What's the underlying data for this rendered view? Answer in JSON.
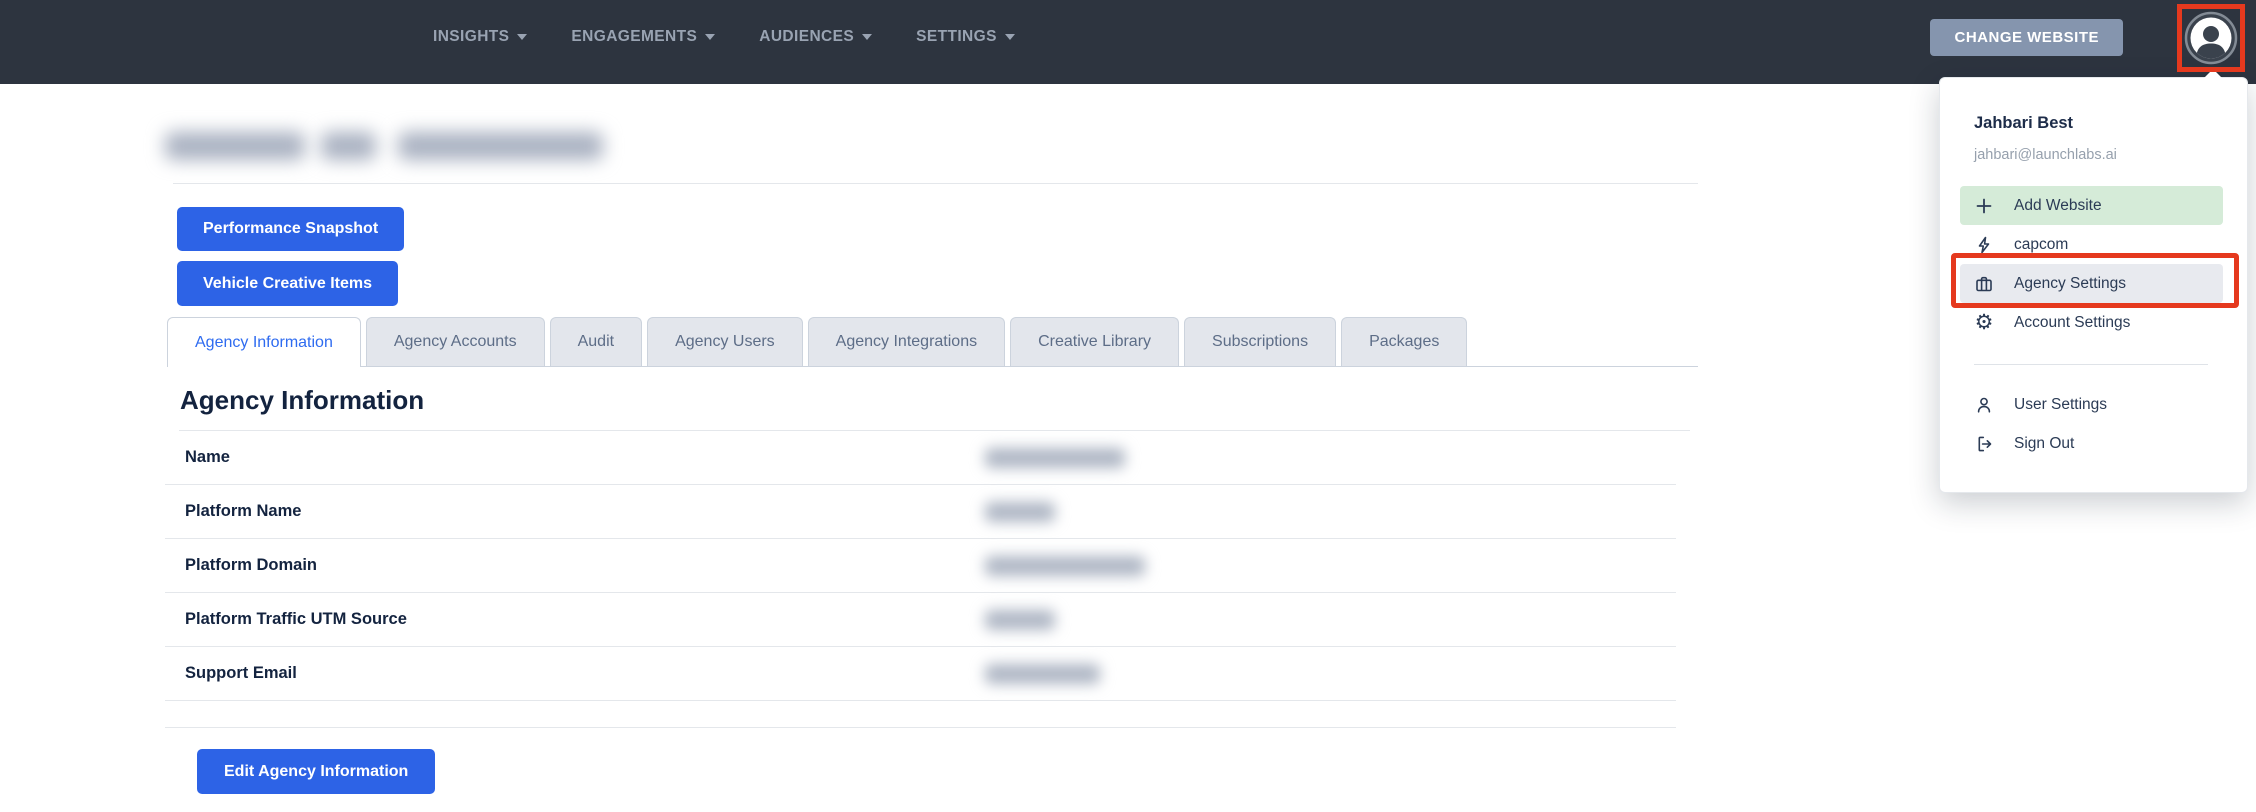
{
  "navbar": {
    "menus": [
      {
        "label": "INSIGHTS"
      },
      {
        "label": "ENGAGEMENTS"
      },
      {
        "label": "AUDIENCES"
      },
      {
        "label": "SETTINGS"
      }
    ],
    "change_website_button": "CHANGE WEBSITE"
  },
  "user_menu": {
    "name": "Jahbari Best",
    "email": "jahbari@launchlabs.ai",
    "items": [
      {
        "label": "Add Website",
        "icon": "plus-icon",
        "highlight": "green"
      },
      {
        "label": "capcom",
        "icon": "lightning-icon",
        "highlight": "none"
      },
      {
        "label": "Agency Settings",
        "icon": "briefcase-icon",
        "highlight": "gray",
        "annotated": true
      },
      {
        "label": "Account Settings",
        "icon": "gear-icon",
        "highlight": "none"
      }
    ],
    "footer_items": [
      {
        "label": "User Settings",
        "icon": "user-icon"
      },
      {
        "label": "Sign Out",
        "icon": "sign-out-icon"
      }
    ]
  },
  "page": {
    "title_redacted": true,
    "action_buttons": [
      {
        "label": "Performance Snapshot"
      },
      {
        "label": "Vehicle Creative Items"
      }
    ],
    "tabs": [
      {
        "label": "Agency Information",
        "active": true
      },
      {
        "label": "Agency Accounts"
      },
      {
        "label": "Audit"
      },
      {
        "label": "Agency Users"
      },
      {
        "label": "Agency Integrations"
      },
      {
        "label": "Creative Library"
      },
      {
        "label": "Subscriptions"
      },
      {
        "label": "Packages"
      }
    ],
    "section_title": "Agency Information",
    "fields": [
      {
        "label": "Name",
        "value_redacted": true
      },
      {
        "label": "Platform Name",
        "value_redacted": true
      },
      {
        "label": "Platform Domain",
        "value_redacted": true
      },
      {
        "label": "Platform Traffic UTM Source",
        "value_redacted": true
      },
      {
        "label": "Support Email",
        "value_redacted": true
      }
    ],
    "edit_button": "Edit Agency Information"
  },
  "colors": {
    "navbar_bg": "#2d343f",
    "accent_blue": "#2d63e6",
    "active_tab_blue": "#2e6bf0",
    "annotation_red": "#e5391e",
    "highlight_green": "#d5ebd8",
    "highlight_gray": "#e8eaef"
  }
}
